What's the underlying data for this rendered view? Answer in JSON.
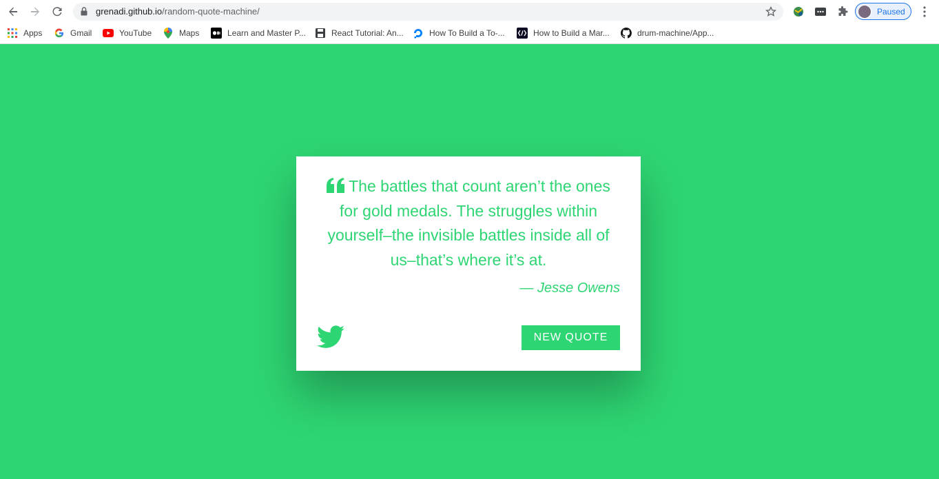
{
  "browser": {
    "url_host": "grenadi.github.io",
    "url_path": "/random-quote-machine/",
    "profile_status": "Paused"
  },
  "bookmarks": [
    {
      "label": "Apps",
      "icon": "apps-grid-icon"
    },
    {
      "label": "Gmail",
      "icon": "google-icon"
    },
    {
      "label": "YouTube",
      "icon": "youtube-icon"
    },
    {
      "label": "Maps",
      "icon": "maps-pin-icon"
    },
    {
      "label": "Learn and Master P...",
      "icon": "medium-icon"
    },
    {
      "label": "React Tutorial: An...",
      "icon": "floppy-icon"
    },
    {
      "label": "How To Build a To-...",
      "icon": "digitalocean-icon"
    },
    {
      "label": "How to Build a Mar...",
      "icon": "code-brackets-icon"
    },
    {
      "label": "drum-machine/App...",
      "icon": "github-icon"
    }
  ],
  "quote": {
    "text": "The battles that count aren’t the ones for gold medals. The struggles within yourself–the invisible battles inside all of us–that’s where it’s at.",
    "author": "— Jesse Owens"
  },
  "buttons": {
    "new_quote": "NEW QUOTE"
  },
  "colors": {
    "accent": "#2ed573",
    "card": "#ffffff"
  }
}
